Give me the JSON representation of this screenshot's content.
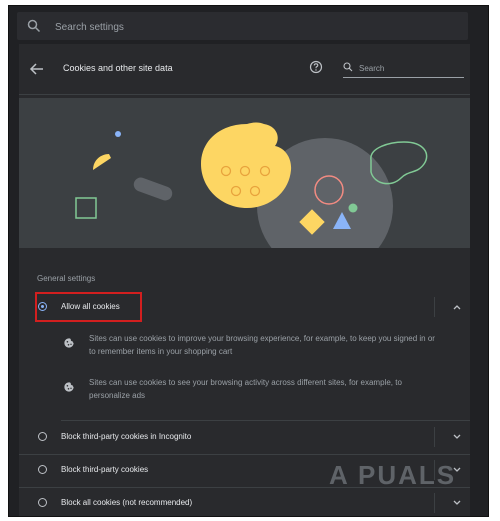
{
  "top_search": {
    "placeholder": "Search settings"
  },
  "header": {
    "title": "Cookies and other site data",
    "search_placeholder": "Search"
  },
  "general_settings": {
    "heading": "General settings"
  },
  "options": [
    {
      "label": "Allow all cookies",
      "selected": true,
      "expanded": true,
      "details": [
        {
          "icon": "cookie-icon",
          "text_line1": "Sites can use cookies to improve your browsing experience, for example, to keep you signed in or",
          "text_line2": "to remember items in your shopping cart"
        },
        {
          "icon": "cookie-icon",
          "text_line1": "Sites can use cookies to see your browsing activity across different sites, for example, to",
          "text_line2": "personalize ads"
        }
      ]
    },
    {
      "label": "Block third-party cookies in Incognito",
      "selected": false
    },
    {
      "label": "Block third-party cookies",
      "selected": false
    },
    {
      "label": "Block all cookies (not recommended)",
      "selected": false
    }
  ],
  "watermark": "A PUALS",
  "colors": {
    "accent": "#8ab4f8",
    "highlight": "#d21f1f",
    "cookie": "#fdd663"
  }
}
